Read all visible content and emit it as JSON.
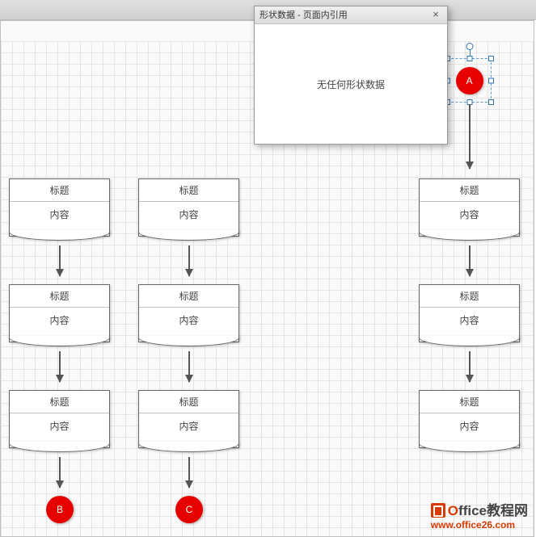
{
  "dialog": {
    "title": "形状数据 - 页面内引用",
    "message": "无任何形状数据",
    "close_icon": "×"
  },
  "nodes": {
    "A": "A",
    "B": "B",
    "C": "C"
  },
  "columns": [
    {
      "shapes": [
        {
          "title": "标题",
          "body": "内容"
        },
        {
          "title": "标题",
          "body": "内容"
        },
        {
          "title": "标题",
          "body": "内容"
        }
      ],
      "end": "B"
    },
    {
      "shapes": [
        {
          "title": "标题",
          "body": "内容"
        },
        {
          "title": "标题",
          "body": "内容"
        },
        {
          "title": "标题",
          "body": "内容"
        }
      ],
      "end": "C"
    },
    {
      "start": "A",
      "shapes": [
        {
          "title": "标题",
          "body": "内容"
        },
        {
          "title": "标题",
          "body": "内容"
        },
        {
          "title": "标题",
          "body": "内容"
        }
      ]
    }
  ],
  "watermark": {
    "line1_prefix": "O",
    "line1_rest": "ffice教程网",
    "line2": "www.office26.com"
  }
}
